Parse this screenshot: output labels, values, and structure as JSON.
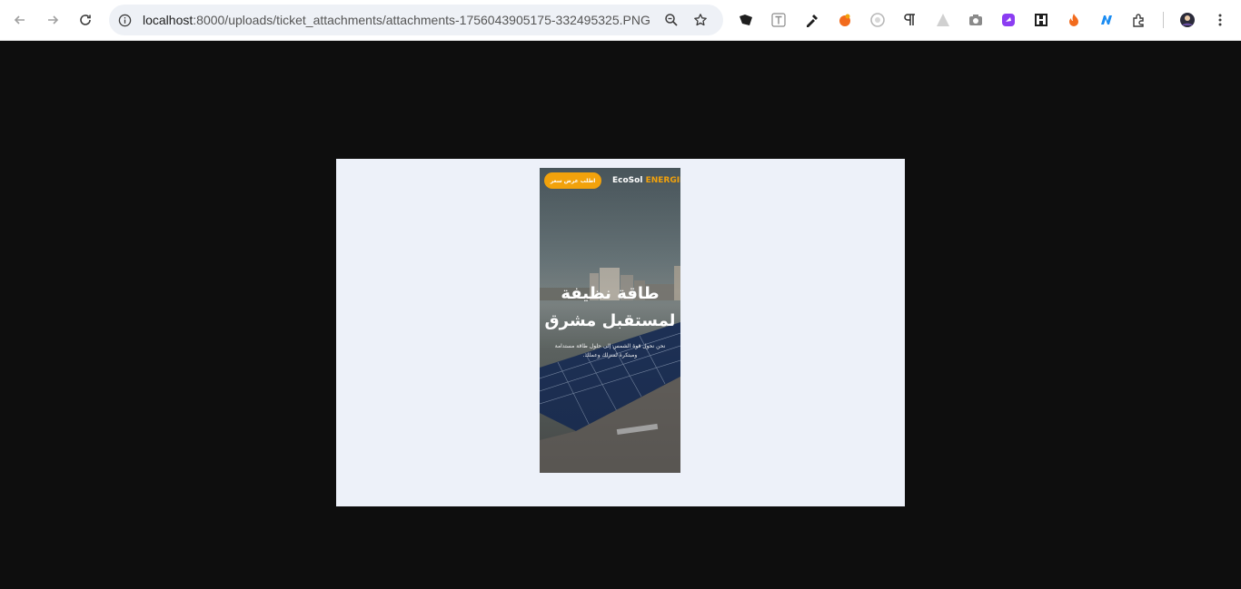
{
  "browser": {
    "url_host": "localhost",
    "url_rest": ":8000/uploads/ticket_attachments/attachments-1756043905175-332495325.PNG",
    "icons": [
      "back-icon",
      "forward-icon",
      "reload-icon",
      "site-info-icon",
      "zoom-icon",
      "bookmark-star-icon",
      "extensions-icon",
      "menu-icon"
    ]
  },
  "poster": {
    "cta": "اطلب عرض سعر",
    "brand_main": "EcoSol",
    "brand_accent": "ENERGIE",
    "headline_line1": "طاقة نظيفة",
    "headline_line2": "لمستقبل مشرق",
    "sub_line1": "نحن نحول قوة الشمس إلى حلول طاقة مستدامة",
    "sub_line2": "ومبتكرة لمنزلك وعملك.",
    "colors": {
      "accent": "#f2a20c",
      "viewer_bg": "#edf1f9",
      "page_bg": "#0e0e0e"
    }
  }
}
